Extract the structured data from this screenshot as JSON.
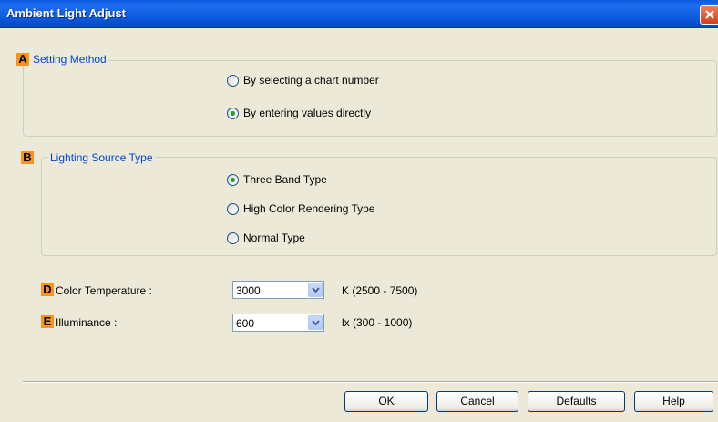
{
  "window": {
    "title": "Ambient Light Adjust"
  },
  "setting_method": {
    "marker": "A",
    "label": "Setting Method",
    "options": [
      {
        "label": "By selecting a chart number",
        "checked": false
      },
      {
        "label": "By entering values directly",
        "checked": true
      }
    ]
  },
  "lighting_source": {
    "marker": "B",
    "label": "Lighting Source Type",
    "options": [
      {
        "label": "Three Band Type",
        "checked": true
      },
      {
        "label": "High Color Rendering Type",
        "checked": false
      },
      {
        "label": "Normal Type",
        "checked": false
      }
    ]
  },
  "color_temperature": {
    "marker": "D",
    "label": "Color Temperature :",
    "value": "3000",
    "range": "K (2500 - 7500)"
  },
  "illuminance": {
    "marker": "E",
    "label": "Illuminance :",
    "value": "600",
    "range": "lx (300 - 1000)"
  },
  "buttons": {
    "ok": "OK",
    "cancel": "Cancel",
    "defaults": "Defaults",
    "help": "Help"
  },
  "icons": {
    "close": "close-icon",
    "dropdown": "chevron-down-icon"
  }
}
